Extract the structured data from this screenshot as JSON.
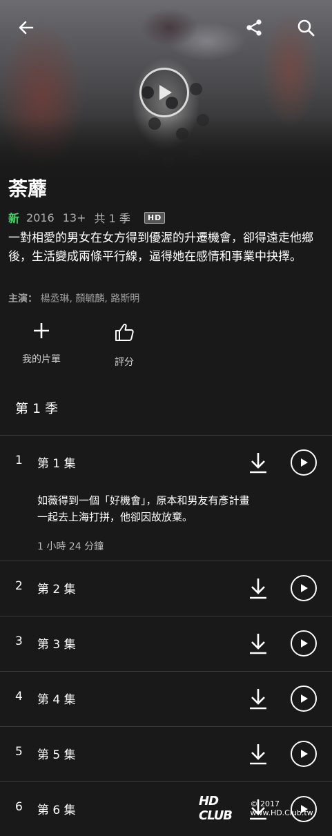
{
  "hero": {
    "image": "drama-still-woman-in-polka-dot-coat",
    "play_icon": "play-icon"
  },
  "toolbar": {
    "back_icon": "back-arrow-icon",
    "share_icon": "share-icon",
    "search_icon": "search-icon"
  },
  "show": {
    "title": "荼蘼",
    "new_badge": "新",
    "year": "2016",
    "rating": "13+",
    "seasons": "共 1 季",
    "quality": "HD",
    "synopsis": "一對相愛的男女在女方得到優渥的升遷機會，卻得遠走他鄉後，生活變成兩條平行線，逼得她在感情和事業中抉擇。",
    "cast_label": "主演：",
    "cast": "楊丞琳, 顏毓麟, 路斯明"
  },
  "actions": [
    {
      "label": "我的片單",
      "icon": "plus-icon"
    },
    {
      "label": "評分",
      "icon": "thumbs-up-icon"
    }
  ],
  "season_label": "第 1 季",
  "episodes": [
    {
      "num": "1",
      "title": "第 1 集",
      "description": "如薇得到一個「好機會」，原本和男友有彥計畫一起去上海打拼，他卻因故放棄。",
      "duration": "1 小時 24 分鐘"
    },
    {
      "num": "2",
      "title": "第 2 集"
    },
    {
      "num": "3",
      "title": "第 3 集"
    },
    {
      "num": "4",
      "title": "第 4 集"
    },
    {
      "num": "5",
      "title": "第 5 集"
    },
    {
      "num": "6",
      "title": "第 6 集"
    }
  ],
  "watermark": {
    "logo": "HD CLUB",
    "text": "© 2017 www.HD.Club.tw"
  },
  "colors": {
    "background": "#191919",
    "new_badge": "#46d369",
    "divider": "#3a3a3a"
  }
}
